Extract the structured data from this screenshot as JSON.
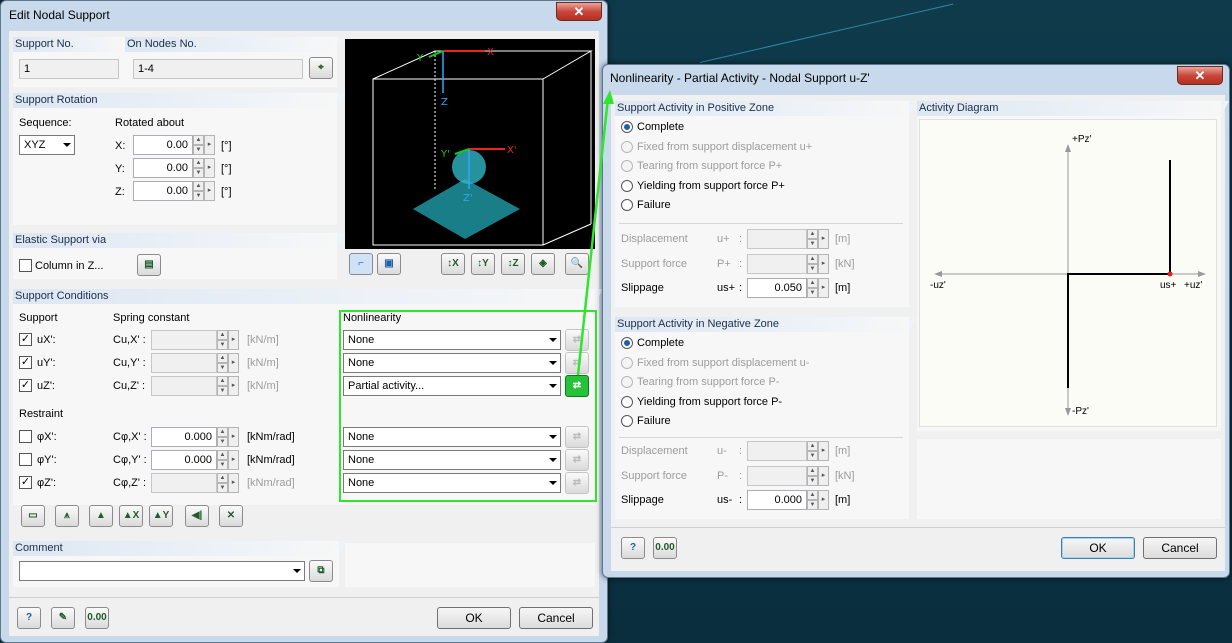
{
  "main_dialog": {
    "title": "Edit Nodal Support",
    "close_symbol": "✕",
    "support_no": {
      "label": "Support No.",
      "value": "1"
    },
    "on_nodes": {
      "label": "On Nodes No.",
      "value": "1-4"
    },
    "rotation": {
      "header": "Support Rotation",
      "sequence_label": "Sequence:",
      "sequence_value": "XYZ",
      "rotated_about": "Rotated about",
      "unit": "[°]",
      "axes": [
        {
          "label": "X:",
          "value": "0.00"
        },
        {
          "label": "Y:",
          "value": "0.00"
        },
        {
          "label": "Z:",
          "value": "0.00"
        }
      ]
    },
    "elastic": {
      "header": "Elastic Support via",
      "checkbox_label": "Column in Z..."
    },
    "conditions": {
      "header": "Support Conditions",
      "support_label": "Support",
      "spring_label": "Spring constant",
      "nonlin_label": "Nonlinearity",
      "restraint_label": "Restraint",
      "support_rows": [
        {
          "name": "uX':",
          "spring": "Cu,X' :",
          "value": "",
          "unit": "[kN/m]",
          "checked": true,
          "nonlin": "None"
        },
        {
          "name": "uY':",
          "spring": "Cu,Y' :",
          "value": "",
          "unit": "[kN/m]",
          "checked": true,
          "nonlin": "None"
        },
        {
          "name": "uZ':",
          "spring": "Cu,Z' :",
          "value": "",
          "unit": "[kN/m]",
          "checked": true,
          "nonlin": "Partial activity..."
        }
      ],
      "restraint_rows": [
        {
          "name": "φX':",
          "spring": "Cφ,X' :",
          "value": "0.000",
          "unit": "[kNm/rad]",
          "checked": false,
          "nonlin": "None"
        },
        {
          "name": "φY':",
          "spring": "Cφ,Y' :",
          "value": "0.000",
          "unit": "[kNm/rad]",
          "checked": false,
          "nonlin": "None"
        },
        {
          "name": "φZ':",
          "spring": "Cφ,Z' :",
          "value": "",
          "unit": "[kNm/rad]",
          "checked": true,
          "nonlin": "None"
        }
      ]
    },
    "comment": {
      "label": "Comment",
      "value": ""
    },
    "ok_label": "OK",
    "cancel_label": "Cancel",
    "preview": {
      "labels": [
        "Y",
        "X",
        "Z",
        "Y'",
        "X'",
        "Z'"
      ]
    }
  },
  "nonlin_dialog": {
    "title": "Nonlinearity - Partial Activity - Nodal Support u-Z'",
    "close_symbol": "✕",
    "positive": {
      "header": "Support Activity in Positive Zone",
      "options": [
        "Complete",
        "Fixed from support displacement u+",
        "Tearing from support force P+",
        "Yielding from support force P+",
        "Failure"
      ],
      "selected": 0,
      "rows": [
        {
          "label": "Displacement",
          "sym": "u+",
          "colon": ":",
          "value": "",
          "unit": "[m]"
        },
        {
          "label": "Support force",
          "sym": "P+",
          "colon": ":",
          "value": "",
          "unit": "[kN]"
        },
        {
          "label": "Slippage",
          "sym": "us+",
          "colon": ":",
          "value": "0.050",
          "unit": "[m]"
        }
      ]
    },
    "negative": {
      "header": "Support Activity in Negative Zone",
      "options": [
        "Complete",
        "Fixed from support displacement u-",
        "Tearing from support force P-",
        "Yielding from support force P-",
        "Failure"
      ],
      "selected": 0,
      "rows": [
        {
          "label": "Displacement",
          "sym": "u-",
          "colon": ":",
          "value": "",
          "unit": "[m]"
        },
        {
          "label": "Support force",
          "sym": "P-",
          "colon": ":",
          "value": "",
          "unit": "[kN]"
        },
        {
          "label": "Slippage",
          "sym": "us-",
          "colon": ":",
          "value": "0.000",
          "unit": "[m]"
        }
      ]
    },
    "diagram": {
      "header": "Activity Diagram",
      "pz_pos": "+Pz'",
      "pz_neg": "-Pz'",
      "uz_neg": "-uz'",
      "uz_pos": "+uz'",
      "us_plus": "us+"
    },
    "ok_label": "OK",
    "cancel_label": "Cancel"
  },
  "colors": {
    "highlight": "#2ee62e",
    "accent": "#1d5fa8",
    "support_blue": "#3aa8c0"
  }
}
